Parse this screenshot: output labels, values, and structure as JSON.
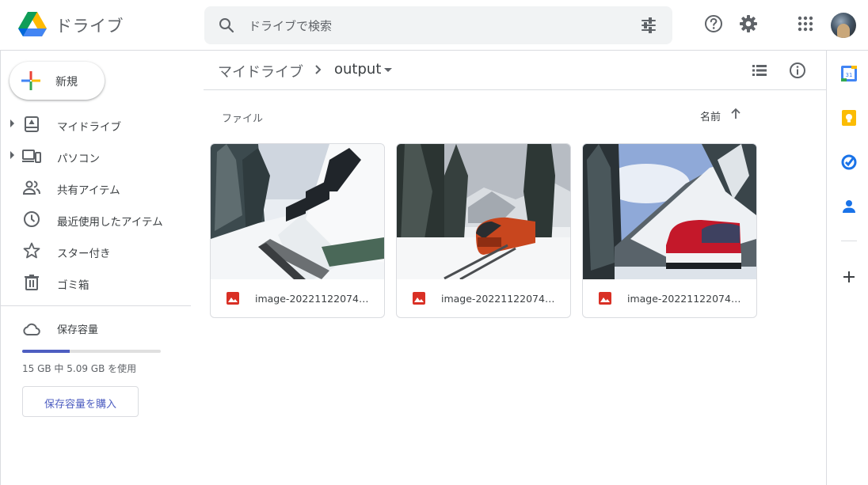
{
  "app": {
    "title": "ドライブ"
  },
  "search": {
    "placeholder": "ドライブで検索"
  },
  "header": {
    "icons": [
      "search-icon",
      "tune-icon",
      "help-icon",
      "gear-icon",
      "apps-grid-icon",
      "avatar"
    ]
  },
  "sidebar": {
    "new_label": "新規",
    "items": [
      {
        "label": "マイドライブ",
        "icon": "my-drive-icon",
        "expandable": true
      },
      {
        "label": "パソコン",
        "icon": "computers-icon",
        "expandable": true
      },
      {
        "label": "共有アイテム",
        "icon": "shared-icon",
        "expandable": false
      },
      {
        "label": "最近使用したアイテム",
        "icon": "recent-icon",
        "expandable": false
      },
      {
        "label": "スター付き",
        "icon": "star-icon",
        "expandable": false
      },
      {
        "label": "ゴミ箱",
        "icon": "trash-icon",
        "expandable": false
      }
    ],
    "storage": {
      "title": "保存容量",
      "usage_text": "15 GB 中 5.09 GB を使用",
      "used_fraction": 0.34,
      "buy_label": "保存容量を購入",
      "accent": "#4e5ec1"
    }
  },
  "breadcrumb": {
    "root": "マイドライブ",
    "current": "output"
  },
  "files_section": {
    "label": "ファイル",
    "sort_label": "名前",
    "files": [
      {
        "name": "image-2022112207405..."
      },
      {
        "name": "image-2022112207405..."
      },
      {
        "name": "image-2022112207405..."
      }
    ]
  },
  "colors": {
    "image_file_icon": "#d93025",
    "accent": "#4e5ec1"
  }
}
